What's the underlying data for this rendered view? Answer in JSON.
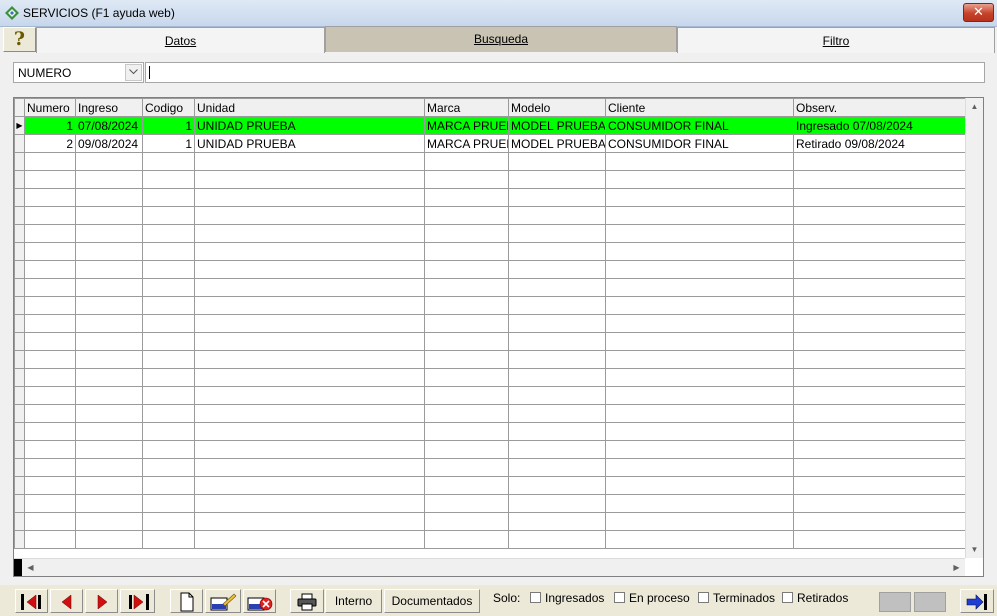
{
  "window": {
    "title": "SERVICIOS (F1 ayuda web)",
    "close_label": "✕"
  },
  "tabs": [
    {
      "label": "Datos",
      "active": false
    },
    {
      "label": "Busqueda",
      "active": true
    },
    {
      "label": "Filtro",
      "active": false
    }
  ],
  "help_label": "?",
  "search": {
    "field_selected": "NUMERO",
    "value": ""
  },
  "grid": {
    "columns": [
      "Numero",
      "Ingreso",
      "Codigo",
      "Unidad",
      "Marca",
      "Modelo",
      "Cliente",
      "Observ."
    ],
    "rows": [
      [
        "1",
        "07/08/2024",
        "1",
        "UNIDAD PRUEBA",
        "MARCA PRUEBA",
        "MODEL PRUEBA",
        "CONSUMIDOR FINAL",
        "Ingresado 07/08/2024"
      ],
      [
        "2",
        "09/08/2024",
        "1",
        "UNIDAD PRUEBA",
        "MARCA PRUEBA",
        "MODEL PRUEBA",
        "CONSUMIDOR FINAL",
        "Retirado 09/08/2024"
      ]
    ],
    "selected_row_color": "#00ff00"
  },
  "toolbar": {
    "interno_label": "Interno",
    "documentados_label": "Documentados",
    "solo_label": "Solo:",
    "filters": [
      {
        "label": "Ingresados",
        "checked": false
      },
      {
        "label": "En proceso",
        "checked": false
      },
      {
        "label": "Terminados",
        "checked": false
      },
      {
        "label": "Retirados",
        "checked": false
      }
    ]
  }
}
